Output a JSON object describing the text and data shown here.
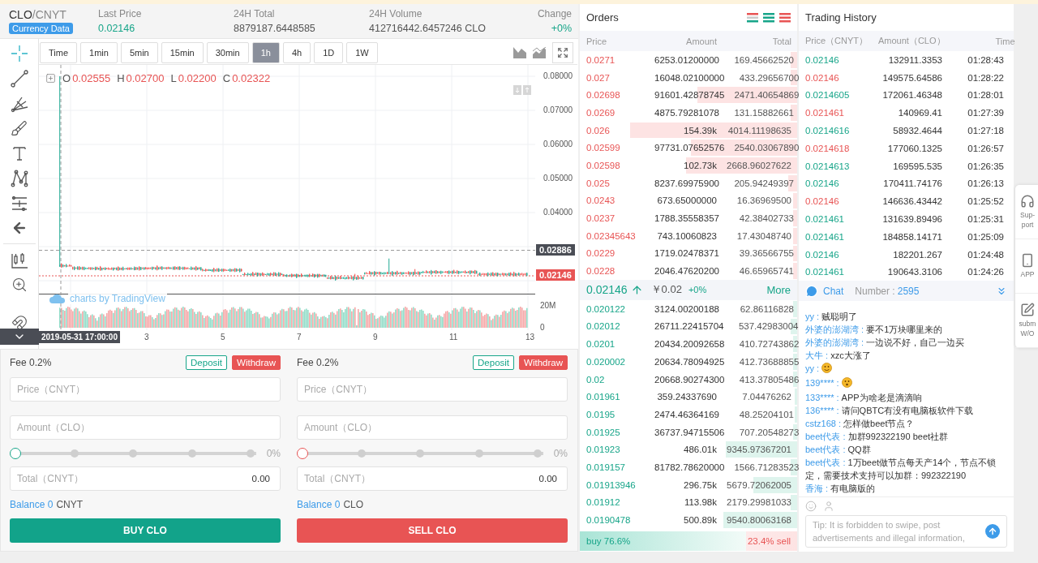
{
  "header": {
    "base": "CLO",
    "quote": "/CNYT",
    "badge": "Currency Data",
    "stats": [
      {
        "label": "Last Price",
        "value": "0.02146",
        "color": "#17a589"
      },
      {
        "label": "24H Total",
        "value": "8879187.6448585",
        "color": "#555555"
      },
      {
        "label": "24H Volume",
        "value": "412716442.6457246 CLO",
        "color": "#555555"
      },
      {
        "label": "Change",
        "value": "+0%",
        "color": "#17a589"
      }
    ]
  },
  "chart": {
    "intervals": [
      {
        "label": "Time",
        "selected": false
      },
      {
        "label": "1min",
        "selected": false
      },
      {
        "label": "5min",
        "selected": false
      },
      {
        "label": "15min",
        "selected": false
      },
      {
        "label": "30min",
        "selected": false
      },
      {
        "label": "1h",
        "selected": true
      },
      {
        "label": "4h",
        "selected": false
      },
      {
        "label": "1D",
        "selected": false
      },
      {
        "label": "1W",
        "selected": false
      }
    ],
    "legend": [
      {
        "key": "O",
        "value": "0.02555"
      },
      {
        "key": "H",
        "value": "0.02700"
      },
      {
        "key": "L",
        "value": "0.02200"
      },
      {
        "key": "C",
        "value": "0.02322"
      }
    ],
    "price_ticks": [
      "0.08000",
      "0.07000",
      "0.06000",
      "0.05000",
      "0.04000"
    ],
    "crosshair_price": "0.02886",
    "last_price": "0.02146",
    "volume_ticks": [
      "20M",
      "0"
    ],
    "crosshair_time": "2019-05-31 17:00:00",
    "time_ticks": [
      "3",
      "5",
      "7",
      "9",
      "11",
      "13"
    ],
    "attribution": "charts by TradingView"
  },
  "orders": {
    "title": "Orders",
    "columns": [
      "Price",
      "Amount",
      "Total"
    ],
    "asks": [
      {
        "price": "0.0271",
        "amount": "6253.01200000",
        "total": "169.45662520",
        "level": 0.03
      },
      {
        "price": "0.027",
        "amount": "16048.02100000",
        "total": "433.29656700",
        "level": 0.03
      },
      {
        "price": "0.02698",
        "amount": "91601.42878745",
        "total": "2471.40654869",
        "level": 0.46
      },
      {
        "price": "0.0269",
        "amount": "4875.79281078",
        "total": "131.15882661",
        "level": 0.03
      },
      {
        "price": "0.026",
        "amount": "154.39k",
        "total": "4014.11198635",
        "level": 0.77
      },
      {
        "price": "0.02599",
        "amount": "97731.07652576",
        "total": "2540.03067890",
        "level": 0.49
      },
      {
        "price": "0.02598",
        "amount": "102.73k",
        "total": "2668.96027622",
        "level": 0.51
      },
      {
        "price": "0.025",
        "amount": "8237.69975900",
        "total": "205.94249397",
        "level": 0.04
      },
      {
        "price": "0.0243",
        "amount": "673.65000000",
        "total": "16.36969500",
        "level": 0.02
      },
      {
        "price": "0.0237",
        "amount": "1788.35558357",
        "total": "42.38402733",
        "level": 0.02
      },
      {
        "price": "0.02345643",
        "amount": "743.10060823",
        "total": "17.43048740",
        "level": 0.02
      },
      {
        "price": "0.0229",
        "amount": "1719.02478371",
        "total": "39.36566755",
        "level": 0.02
      },
      {
        "price": "0.0228",
        "amount": "2046.47620200",
        "total": "46.65965741",
        "level": 0.02
      }
    ],
    "mid": {
      "price": "0.02146",
      "cny": "￥0.02",
      "change": "+0%",
      "more": "More"
    },
    "bids": [
      {
        "price": "0.020122",
        "amount": "3124.00200188",
        "total": "62.86116828",
        "level": 0.02
      },
      {
        "price": "0.02012",
        "amount": "26711.22415704",
        "total": "537.42983004",
        "level": 0.03
      },
      {
        "price": "0.0201",
        "amount": "20434.20092658",
        "total": "410.72743862",
        "level": 0.02
      },
      {
        "price": "0.020002",
        "amount": "20634.78094925",
        "total": "412.73688855",
        "level": 0.02
      },
      {
        "price": "0.02",
        "amount": "20668.90274300",
        "total": "413.37805486",
        "level": 0.02
      },
      {
        "price": "0.01961",
        "amount": "359.24337690",
        "total": "7.04476262",
        "level": 0.01
      },
      {
        "price": "0.0195",
        "amount": "2474.46364169",
        "total": "48.25204101",
        "level": 0.01
      },
      {
        "price": "0.01925",
        "amount": "36737.94715506",
        "total": "707.20548273",
        "level": 0.02
      },
      {
        "price": "0.01923",
        "amount": "486.01k",
        "total": "9345.97367201",
        "level": 0.33
      },
      {
        "price": "0.019157",
        "amount": "81782.78620000",
        "total": "1566.71283523",
        "level": 0.03
      },
      {
        "price": "0.01913946",
        "amount": "296.75k",
        "total": "5679.72062005",
        "level": 0.2
      },
      {
        "price": "0.01912",
        "amount": "113.98k",
        "total": "2179.29981033",
        "level": 0.03
      },
      {
        "price": "0.0190478",
        "amount": "500.89k",
        "total": "9540.80063168",
        "level": 0.34
      }
    ],
    "ratio": {
      "buy": "buy 76.6%",
      "sell": "23.4% sell",
      "level": 0.766
    }
  },
  "history": {
    "title": "Trading History",
    "columns": [
      "Price（CNYT）",
      "Amount（CLO）",
      "Time"
    ],
    "rows": [
      {
        "price": "0.02146",
        "color": "#17a589",
        "amount": "132911.3353",
        "time": "01:28:43"
      },
      {
        "price": "0.02146",
        "color": "#e85454",
        "amount": "149575.64586",
        "time": "01:28:22"
      },
      {
        "price": "0.0214605",
        "color": "#17a589",
        "amount": "172061.46348",
        "time": "01:28:01"
      },
      {
        "price": "0.021461",
        "color": "#e85454",
        "amount": "140969.41",
        "time": "01:27:39"
      },
      {
        "price": "0.0214616",
        "color": "#17a589",
        "amount": "58932.4644",
        "time": "01:27:18"
      },
      {
        "price": "0.0214618",
        "color": "#e85454",
        "amount": "177060.1325",
        "time": "01:26:57"
      },
      {
        "price": "0.0214613",
        "color": "#17a589",
        "amount": "169595.535",
        "time": "01:26:35"
      },
      {
        "price": "0.02146",
        "color": "#17a589",
        "amount": "170411.74176",
        "time": "01:26:13"
      },
      {
        "price": "0.02146",
        "color": "#e85454",
        "amount": "146636.43442",
        "time": "01:25:52"
      },
      {
        "price": "0.021461",
        "color": "#17a589",
        "amount": "131639.89496",
        "time": "01:25:31"
      },
      {
        "price": "0.021461",
        "color": "#17a589",
        "amount": "184858.14171",
        "time": "01:25:09"
      },
      {
        "price": "0.02146",
        "color": "#17a589",
        "amount": "182201.267",
        "time": "01:24:48"
      },
      {
        "price": "0.021461",
        "color": "#17a589",
        "amount": "190643.3106",
        "time": "01:24:26"
      }
    ]
  },
  "chat": {
    "title": "Chat",
    "count_label": "Number :",
    "count": "2595",
    "messages": [
      {
        "kind": "text",
        "user": "yy :",
        "text": "贼聪明了"
      },
      {
        "kind": "text",
        "user": "外婆的澎湖湾 :",
        "text": "要不1万块哪里来的"
      },
      {
        "kind": "text",
        "user": "外婆的澎湖湾 :",
        "text": "一边说不好，自己一边买"
      },
      {
        "kind": "text",
        "user": "大牛 :",
        "text": "xzc大涨了"
      },
      {
        "kind": "emoji",
        "user": "yy :"
      },
      {
        "kind": "emoji",
        "user": "139**** :"
      },
      {
        "kind": "text",
        "user": "133**** :",
        "text": "APP为啥老是滴滴响"
      },
      {
        "kind": "text",
        "user": "136**** :",
        "text": "请问QBTC有没有电脑板软件下载"
      },
      {
        "kind": "text",
        "user": "cstz168 :",
        "text": "怎样做beet节点？"
      },
      {
        "kind": "text",
        "user": "beet代表 :",
        "text": "加群992322190 beet社群"
      },
      {
        "kind": "text",
        "user": "beet代表 :",
        "text": "QQ群"
      },
      {
        "kind": "text",
        "user": "beet代表 :",
        "text": "1万beet做节点每天产14个，节点不锁定，需要技术支持可以加群：992322190"
      },
      {
        "kind": "text",
        "user": "香海 :",
        "text": "有电脑版的"
      }
    ],
    "placeholder": "Tip: It is forbidden to swipe, post advertisements and illegal information,"
  },
  "forms": [
    {
      "kind": "buy",
      "fee": "Fee 0.2%",
      "deposit": "Deposit",
      "withdraw": "Withdraw",
      "price_placeholder": "Price（CNYT）",
      "amount_placeholder": "Amount（CLO）",
      "level": 0,
      "percent": "0%",
      "total_label": "Total（CNYT）",
      "total_value": "0.00",
      "balance": "Balance 0",
      "unit": "CNYT",
      "submit": "BUY CLO"
    },
    {
      "kind": "sell",
      "fee": "Fee 0.2%",
      "deposit": "Deposit",
      "withdraw": "Withdraw",
      "price_placeholder": "Price（CNYT）",
      "amount_placeholder": "Amount（CLO）",
      "level": 0,
      "percent": "0%",
      "total_label": "Total（CNYT）",
      "total_value": "0.00",
      "balance": "Balance 0",
      "unit": "CLO",
      "submit": "SELL CLO"
    }
  ],
  "float_menu": [
    {
      "kind": "support",
      "lines": [
        "Sup-",
        "port"
      ]
    },
    {
      "kind": "app",
      "lines": [
        "APP"
      ]
    },
    {
      "kind": "submit",
      "lines": [
        "subm",
        "W/O"
      ]
    }
  ]
}
